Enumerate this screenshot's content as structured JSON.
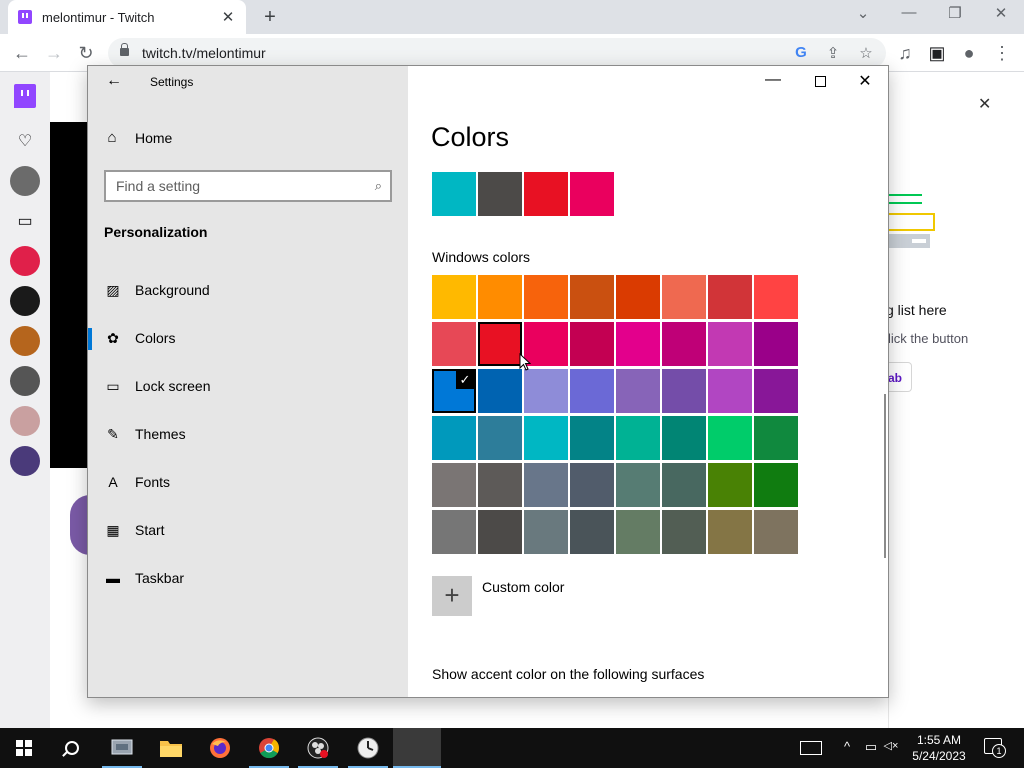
{
  "browser": {
    "tab_title": "melontimur - Twitch",
    "tab_close": "✕",
    "new_tab": "+",
    "url": "twitch.tv/melontimur",
    "nav": {
      "back": "←",
      "forward": "→",
      "reload": "↻"
    },
    "window_controls": {
      "tab_search": "⌄",
      "minimize": "—",
      "restore": "❐",
      "close": "✕"
    },
    "toolbar_icons": {
      "google": "G",
      "share": "⇪",
      "bookmark": "☆",
      "media": "♫",
      "sidepanel": "▣",
      "profile": "●",
      "menu": "⋮"
    }
  },
  "twitch": {
    "right_close": "✕",
    "list_text": "g list here",
    "click_text": "lick the button",
    "tab_btn": "ab",
    "side_icons": {
      "heart": "♡",
      "video": "▭"
    },
    "avatar_colors": [
      "#6b6b6b",
      "#e0204a",
      "#1a1a1a",
      "#b5651d",
      "#555555",
      "#c9a0a0",
      "#4a3a7a"
    ]
  },
  "settings": {
    "title": "Settings",
    "back": "←",
    "home_label": "Home",
    "search_placeholder": "Find a setting",
    "section": "Personalization",
    "nav_items": [
      {
        "label": "Background",
        "icon": "▨"
      },
      {
        "label": "Colors",
        "icon": "✿"
      },
      {
        "label": "Lock screen",
        "icon": "▭"
      },
      {
        "label": "Themes",
        "icon": "✎"
      },
      {
        "label": "Fonts",
        "icon": "A"
      },
      {
        "label": "Start",
        "icon": "▦"
      },
      {
        "label": "Taskbar",
        "icon": "▬"
      }
    ],
    "active_item": "Colors",
    "window": {
      "minimize": "—",
      "close": "✕"
    },
    "heading": "Colors",
    "recent_colors": [
      "#00b7c3",
      "#4c4a48",
      "#e81123",
      "#ea005e"
    ],
    "windows_colors_label": "Windows colors",
    "windows_colors": [
      [
        "#ffb900",
        "#ff8c00",
        "#f7630c",
        "#ca5010",
        "#da3b01",
        "#ef6950",
        "#d13438",
        "#ff4343"
      ],
      [
        "#e74856",
        "#e81123",
        "#ea005e",
        "#c30052",
        "#e3008c",
        "#bf0077",
        "#c239b3",
        "#9a0089"
      ],
      [
        "#0078d7",
        "#0063b1",
        "#8e8cd8",
        "#6b69d6",
        "#8764b8",
        "#744da9",
        "#b146c2",
        "#881798"
      ],
      [
        "#0099bc",
        "#2d7d9a",
        "#00b7c3",
        "#038387",
        "#00b294",
        "#018574",
        "#00cc6a",
        "#10893e"
      ],
      [
        "#7a7574",
        "#5d5a58",
        "#68768a",
        "#515c6b",
        "#567c73",
        "#486860",
        "#498205",
        "#107c10"
      ],
      [
        "#767676",
        "#4c4a48",
        "#69797e",
        "#4a5459",
        "#647c64",
        "#525e54",
        "#847545",
        "#7e735f"
      ]
    ],
    "hover_color": "#e81123",
    "checked_color": "#0078d7",
    "check_mark": "✓",
    "custom_color_label": "Custom color",
    "plus": "+",
    "accent_surfaces_text": "Show accent color on the following surfaces"
  },
  "taskbar": {
    "time": "1:55 AM",
    "date": "5/24/2023",
    "notification_count": "1",
    "tray": {
      "chevron": "^",
      "network": "▭",
      "volume": "◁×"
    }
  }
}
